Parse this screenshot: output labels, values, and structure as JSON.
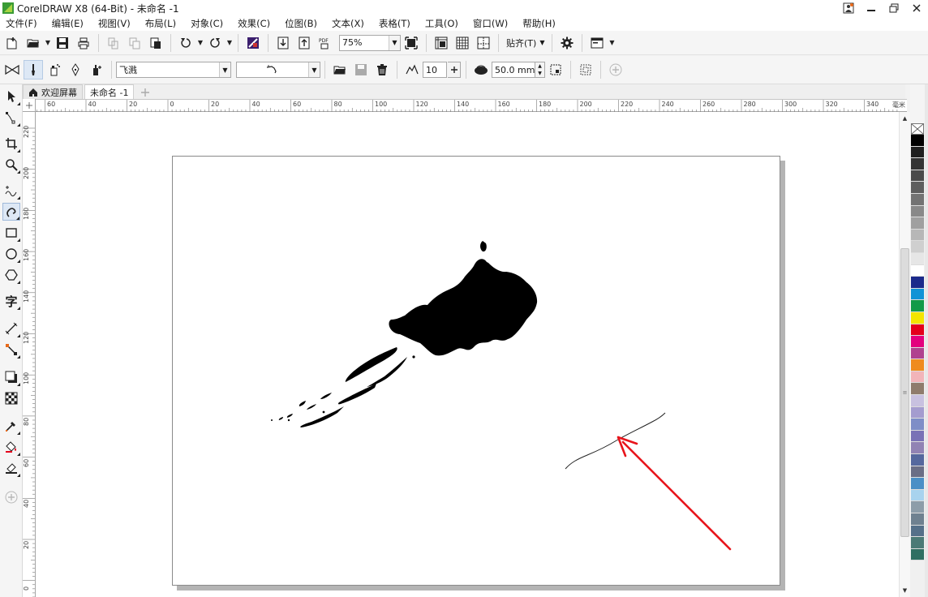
{
  "window": {
    "title": "CorelDRAW X8 (64-Bit) - 未命名 -1"
  },
  "menu": [
    "文件(F)",
    "编辑(E)",
    "视图(V)",
    "布局(L)",
    "对象(C)",
    "效果(C)",
    "位图(B)",
    "文本(X)",
    "表格(T)",
    "工具(O)",
    "窗口(W)",
    "帮助(H)"
  ],
  "toolbar": {
    "zoom_value": "75%",
    "snap_label": "贴齐(T)",
    "pdf_label": "PDF"
  },
  "property_bar": {
    "preset_value": "飞溅",
    "stroke_width_value": "10",
    "brush_size_value": "50.0 mm"
  },
  "doc_tabs": [
    {
      "label": "欢迎屏幕",
      "active": false
    },
    {
      "label": "未命名 -1",
      "active": true
    }
  ],
  "ruler": {
    "unit": "毫米",
    "top_labels": [
      "60",
      "40",
      "20",
      "0",
      "20",
      "40",
      "60",
      "80",
      "100",
      "120",
      "140",
      "160",
      "180",
      "200",
      "220",
      "240",
      "260",
      "280",
      "300",
      "320",
      "340"
    ],
    "left_labels": [
      "220",
      "200",
      "180",
      "160",
      "140",
      "120",
      "100",
      "80",
      "60",
      "40",
      "20",
      "0"
    ]
  },
  "palette_colors": [
    "#000000",
    "#1f1f1f",
    "#333333",
    "#4a4a4a",
    "#5e5e5e",
    "#737373",
    "#898989",
    "#a0a0a0",
    "#b7b7b7",
    "#cfcfcf",
    "#e6e6e6",
    "#ffffff",
    "#1b2a8b",
    "#1193d6",
    "#129a48",
    "#f3e500",
    "#e4001b",
    "#e3007e",
    "#b0428f",
    "#ef8b1e",
    "#f2b4b9",
    "#8f7c6c",
    "#c8c1e0",
    "#a49ccf",
    "#7e8ec7",
    "#7a72b6",
    "#9183b4",
    "#55689e",
    "#6a6e86",
    "#4b8fc6",
    "#a8d3ee",
    "#8d9da9",
    "#6f8190",
    "#557089",
    "#4b7a76",
    "#2f6f62"
  ],
  "colors": {
    "accent": "#1d8fd6",
    "arrow": "#e8141b",
    "tab_active": "#ffffff"
  }
}
